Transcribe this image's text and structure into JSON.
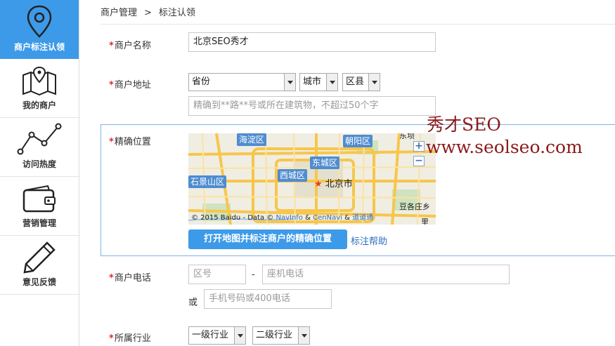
{
  "sidebar": {
    "items": [
      {
        "label": "商户标注认领",
        "icon": "location-pin-icon",
        "active": true
      },
      {
        "label": "我的商户",
        "icon": "map-icon",
        "active": false
      },
      {
        "label": "访问热度",
        "icon": "line-chart-icon",
        "active": false
      },
      {
        "label": "营销管理",
        "icon": "wallet-icon",
        "active": false
      },
      {
        "label": "意见反馈",
        "icon": "pencil-icon",
        "active": false
      }
    ]
  },
  "breadcrumb": {
    "parent": "商户管理",
    "separator": ">",
    "current": "标注认领"
  },
  "form": {
    "required_mark": "*",
    "name": {
      "label": "商户名称",
      "value": "北京SEO秀才"
    },
    "address": {
      "label": "商户地址",
      "province": "省份",
      "city": "城市",
      "district": "区县",
      "detail_placeholder": "精确到**路**号或所在建筑物，不超过50个字"
    },
    "location": {
      "label": "精确位置",
      "open_map_button": "打开地图并标注商户的精确位置",
      "help_link": "标注帮助",
      "map": {
        "districts": [
          "海淀区",
          "朝阳区",
          "东城区",
          "西城区",
          "石景山区"
        ],
        "city_label": "北京市",
        "edge_labels": [
          "东坝",
          "豆各庄乡",
          "里"
        ],
        "zoom_in": "+",
        "zoom_out": "−",
        "copyright_prefix": "© 2015 Baidu - Data ©",
        "copyright_links": [
          "NavInfo",
          "&",
          "CenNavi",
          "&",
          "道道通"
        ]
      }
    },
    "phone": {
      "label": "商户电话",
      "area_placeholder": "区号",
      "dash": "-",
      "landline_placeholder": "座机电话",
      "or": "或",
      "mobile_placeholder": "手机号码或400电话"
    },
    "industry": {
      "label": "所属行业",
      "level1": "一级行业",
      "level2": "二级行业"
    }
  },
  "watermark": {
    "line1": "秀才SEO",
    "line2": "www.seolseo.com"
  },
  "colors": {
    "accent": "#3d9ae8",
    "required": "#e12b2b",
    "link": "#2b6fc0",
    "watermark": "#8b1a1a"
  }
}
